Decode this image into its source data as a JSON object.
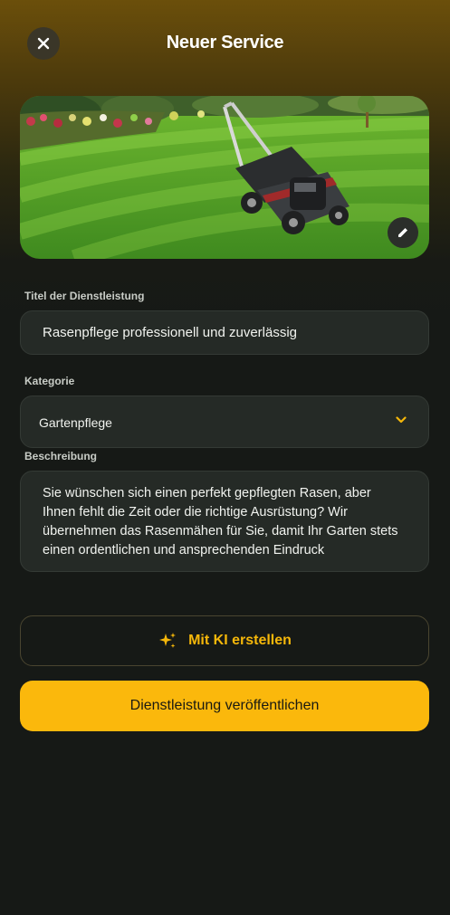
{
  "header": {
    "title": "Neuer Service",
    "close_icon": "close-icon"
  },
  "hero": {
    "edit_icon": "pencil-icon"
  },
  "form": {
    "title_label": "Titel der Dienstleistung",
    "title_value": "Rasenpflege professionell und zuverlässig",
    "category_label": "Kategorie",
    "category_value": "Gartenpflege",
    "description_label": "Beschreibung",
    "description_value": "Sie wünschen sich einen perfekt gepflegten Rasen, aber Ihnen fehlt die Zeit oder die richtige Ausrüstung? Wir übernehmen das Rasenmähen für Sie, damit Ihr Garten stets einen ordentlichen und ansprechenden Eindruck"
  },
  "actions": {
    "ai_label": "Mit KI erstellen",
    "ai_icon": "sparkle-icon",
    "publish_label": "Dienstleistung veröffentlichen"
  },
  "colors": {
    "accent": "#fbb80c",
    "background": "#161916",
    "field": "#252a26"
  }
}
